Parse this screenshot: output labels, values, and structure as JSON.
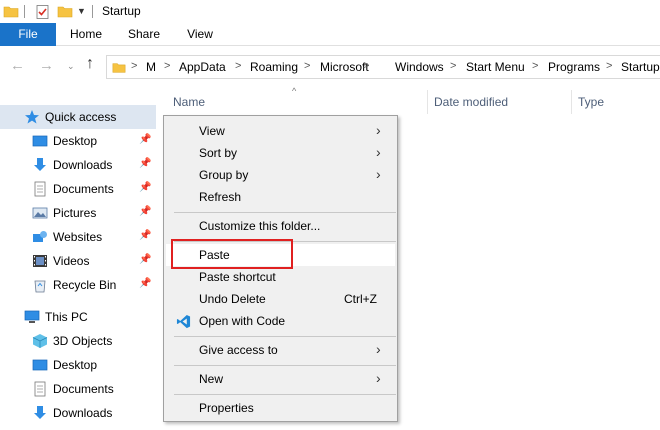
{
  "window": {
    "title": "Startup"
  },
  "ribbon": {
    "tabs": [
      "File",
      "Home",
      "Share",
      "View"
    ]
  },
  "address": {
    "crumbs": [
      "M",
      "AppData",
      "Roaming",
      "Microsoft",
      "Windows",
      "Start Menu",
      "Programs",
      "Startup"
    ]
  },
  "sidebar": {
    "quick_access": "Quick access",
    "items": [
      {
        "label": "Desktop",
        "icon": "desktop-icon",
        "pinned": true
      },
      {
        "label": "Downloads",
        "icon": "downloads-icon",
        "pinned": true
      },
      {
        "label": "Documents",
        "icon": "documents-icon",
        "pinned": true
      },
      {
        "label": "Pictures",
        "icon": "pictures-icon",
        "pinned": true
      },
      {
        "label": "Websites",
        "icon": "websites-icon",
        "pinned": true
      },
      {
        "label": "Videos",
        "icon": "videos-icon",
        "pinned": true
      },
      {
        "label": "Recycle Bin",
        "icon": "recycle-bin-icon",
        "pinned": true
      }
    ],
    "this_pc": "This PC",
    "pc_items": [
      {
        "label": "3D Objects",
        "icon": "3d-objects-icon"
      },
      {
        "label": "Desktop",
        "icon": "desktop-icon"
      },
      {
        "label": "Documents",
        "icon": "documents-icon"
      },
      {
        "label": "Downloads",
        "icon": "downloads-icon"
      }
    ]
  },
  "columns": {
    "name": "Name",
    "date_modified": "Date modified",
    "type": "Type"
  },
  "context_menu": {
    "view": "View",
    "sort_by": "Sort by",
    "group_by": "Group by",
    "refresh": "Refresh",
    "customize": "Customize this folder...",
    "paste": "Paste",
    "paste_shortcut": "Paste shortcut",
    "undo_delete": "Undo Delete",
    "undo_shortcut": "Ctrl+Z",
    "open_with_code": "Open with Code",
    "give_access": "Give access to",
    "new": "New",
    "properties": "Properties"
  },
  "colors": {
    "accent": "#1a73c9",
    "highlight": "#e02020",
    "selected": "#dde6f1"
  }
}
